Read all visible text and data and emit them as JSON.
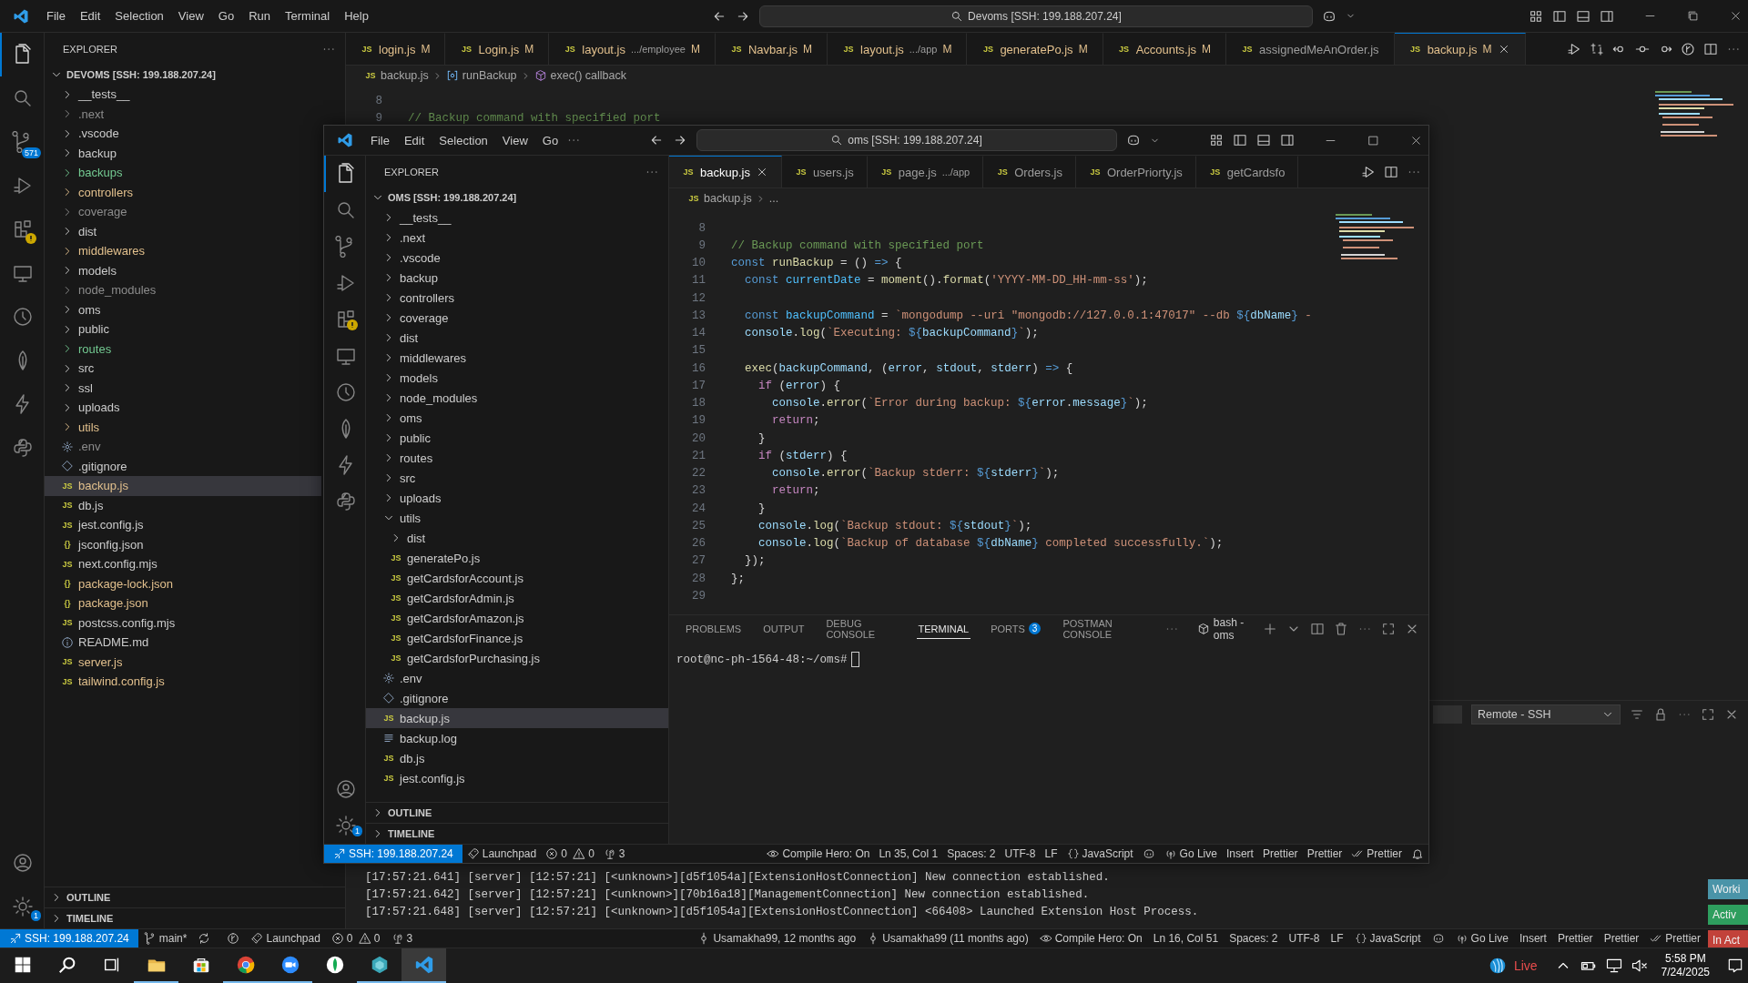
{
  "windows": [
    {
      "kind": "main",
      "maximized": true,
      "menu_overflow": false,
      "menu": [
        "File",
        "Edit",
        "Selection",
        "View",
        "Go",
        "Run",
        "Terminal",
        "Help"
      ],
      "search": "Devoms [SSH: 199.188.207.24]",
      "activity": [
        {
          "kind": "files",
          "selected": true
        },
        {
          "kind": "search",
          "selected": false
        },
        {
          "kind": "scm",
          "selected": false,
          "badge": "571"
        },
        {
          "kind": "run",
          "selected": false
        },
        {
          "kind": "extensions",
          "selected": false,
          "warning": true
        },
        {
          "kind": "remote",
          "selected": false
        },
        {
          "kind": "clock",
          "selected": false
        },
        {
          "kind": "leaf",
          "selected": false
        },
        {
          "kind": "bolt",
          "selected": false
        },
        {
          "kind": "snakes",
          "selected": false
        }
      ],
      "activity_bottom": [
        {
          "kind": "account"
        },
        {
          "kind": "settings",
          "badge": "1"
        }
      ],
      "explorer": {
        "title": "EXPLORER",
        "root": "DEVOMS [SSH: 199.188.207.24]",
        "sections": [
          "OUTLINE",
          "TIMELINE"
        ],
        "items": [
          {
            "name": "__tests__",
            "kind": "folder",
            "expanded": false,
            "selected": false
          },
          {
            "name": ".next",
            "kind": "folder",
            "expanded": false,
            "selected": false,
            "color": "#8c8c8c"
          },
          {
            "name": ".vscode",
            "kind": "folder",
            "expanded": false,
            "selected": false
          },
          {
            "name": "backup",
            "kind": "folder",
            "expanded": false,
            "selected": false
          },
          {
            "name": "backups",
            "kind": "folder",
            "expanded": false,
            "selected": false,
            "color": "#73c991"
          },
          {
            "name": "controllers",
            "kind": "folder",
            "expanded": false,
            "selected": false,
            "color": "#e2c08d"
          },
          {
            "name": "coverage",
            "kind": "folder",
            "expanded": false,
            "selected": false,
            "color": "#8c8c8c"
          },
          {
            "name": "dist",
            "kind": "folder",
            "expanded": false,
            "selected": false
          },
          {
            "name": "middlewares",
            "kind": "folder",
            "expanded": false,
            "selected": false,
            "color": "#e2c08d"
          },
          {
            "name": "models",
            "kind": "folder",
            "expanded": false,
            "selected": false
          },
          {
            "name": "node_modules",
            "kind": "folder",
            "expanded": false,
            "selected": false,
            "color": "#8c8c8c"
          },
          {
            "name": "oms",
            "kind": "folder",
            "expanded": false,
            "selected": false
          },
          {
            "name": "public",
            "kind": "folder",
            "expanded": false,
            "selected": false
          },
          {
            "name": "routes",
            "kind": "folder",
            "expanded": false,
            "selected": false,
            "color": "#73c991"
          },
          {
            "name": "src",
            "kind": "folder",
            "expanded": false,
            "selected": false
          },
          {
            "name": "ssl",
            "kind": "folder",
            "expanded": false,
            "selected": false
          },
          {
            "name": "uploads",
            "kind": "folder",
            "expanded": false,
            "selected": false
          },
          {
            "name": "utils",
            "kind": "folder",
            "expanded": false,
            "selected": false,
            "color": "#e2c08d"
          },
          {
            "name": ".env",
            "kind": "env",
            "selected": false,
            "color": "#8c8c8c"
          },
          {
            "name": ".gitignore",
            "kind": "git",
            "selected": false
          },
          {
            "name": "backup.js",
            "kind": "js",
            "glyph": "JS",
            "selected": true,
            "color": "#e2c08d"
          },
          {
            "name": "db.js",
            "kind": "js",
            "glyph": "JS",
            "selected": false
          },
          {
            "name": "jest.config.js",
            "kind": "js",
            "glyph": "JS",
            "selected": false
          },
          {
            "name": "jsconfig.json",
            "kind": "json",
            "glyph": "{}",
            "selected": false
          },
          {
            "name": "next.config.mjs",
            "kind": "js",
            "glyph": "JS",
            "selected": false
          },
          {
            "name": "package-lock.json",
            "kind": "json",
            "glyph": "{}",
            "selected": false,
            "color": "#e2c08d"
          },
          {
            "name": "package.json",
            "kind": "json",
            "glyph": "{}",
            "selected": false,
            "color": "#e2c08d"
          },
          {
            "name": "postcss.config.mjs",
            "kind": "js",
            "glyph": "JS",
            "selected": false
          },
          {
            "name": "README.md",
            "kind": "info",
            "selected": false
          },
          {
            "name": "server.js",
            "kind": "js",
            "glyph": "JS",
            "selected": false,
            "color": "#e2c08d"
          },
          {
            "name": "tailwind.config.js",
            "kind": "js",
            "glyph": "JS",
            "selected": false,
            "color": "#e2c08d"
          }
        ]
      },
      "tabs": [
        {
          "name": "login.js",
          "glyph": "JS",
          "status": "M",
          "selected": false
        },
        {
          "name": "Login.js",
          "glyph": "JS",
          "status": "M",
          "selected": false
        },
        {
          "name": "layout.js",
          "detail": ".../employee",
          "glyph": "JS",
          "status": "M",
          "selected": false
        },
        {
          "name": "Navbar.js",
          "glyph": "JS",
          "status": "M",
          "selected": false
        },
        {
          "name": "layout.js",
          "detail": ".../app",
          "glyph": "JS",
          "status": "M",
          "selected": false
        },
        {
          "name": "generatePo.js",
          "glyph": "JS",
          "status": "M",
          "selected": false
        },
        {
          "name": "Accounts.js",
          "glyph": "JS",
          "status": "M",
          "selected": false
        },
        {
          "name": "assignedMeAnOrder.js",
          "glyph": "JS",
          "selected": false
        },
        {
          "name": "backup.js",
          "glyph": "JS",
          "status": "M",
          "selected": true
        }
      ],
      "tab_actions": [
        {
          "kind": "run"
        },
        {
          "kind": "compare"
        },
        {
          "kind": "back"
        },
        {
          "kind": "dot"
        },
        {
          "kind": "forward"
        },
        {
          "kind": "graph"
        },
        {
          "kind": "split"
        },
        {
          "kind": "more"
        }
      ],
      "breadcrumb": [
        {
          "glyph": "JS",
          "text": "backup.js"
        },
        {
          "kind": "method",
          "text": "runBackup"
        },
        {
          "kind": "function",
          "text": "exec() callback"
        }
      ],
      "code": [
        {
          "num": "8"
        },
        {
          "num": "9",
          "text": "// Backup command with specified port"
        }
      ],
      "panel": {
        "kind": "output",
        "dropdown": "Remote - SSH",
        "lines": [
          "[17:57:21.641] [server] [12:57:21] [<unknown>][d5f1054a][ExtensionHostConnection] New connection established.",
          "[17:57:21.642] [server] [12:57:21] [<unknown>][70b16a18][ManagementConnection] New connection established.",
          "[17:57:21.648] [server] [12:57:21] [<unknown>][d5f1054a][ExtensionHostConnection] <66408> Launched Extension Host Process."
        ]
      },
      "status_left": [
        {
          "kind": "remote",
          "text": "SSH: 199.188.207.24"
        },
        {
          "kind": "branch",
          "text": "main*"
        },
        {
          "kind": "sync"
        },
        {
          "kind": "graph"
        },
        {
          "kind": "launchpad",
          "text": "Launchpad"
        },
        {
          "kind": "problems",
          "errors": "0",
          "warnings": "0"
        },
        {
          "kind": "ports",
          "text": "3"
        }
      ],
      "status_right": [
        {
          "kind": "blame",
          "text": "Usamakha99, 12 months ago"
        },
        {
          "kind": "blame",
          "text": "Usamakha99 (11 months ago)"
        },
        {
          "kind": "eye",
          "text": "Compile Hero: On"
        },
        {
          "kind": "text",
          "text": "Ln 16, Col 51"
        },
        {
          "kind": "text",
          "text": "Spaces: 2"
        },
        {
          "kind": "text",
          "text": "UTF-8"
        },
        {
          "kind": "text",
          "text": "LF"
        },
        {
          "kind": "language",
          "text": "JavaScript"
        },
        {
          "kind": "copilot"
        },
        {
          "kind": "golive",
          "text": "Go Live"
        },
        {
          "kind": "text",
          "text": "Insert"
        },
        {
          "kind": "text",
          "text": "Prettier"
        },
        {
          "kind": "text",
          "text": "Prettier"
        },
        {
          "kind": "checks",
          "text": "Prettier"
        }
      ]
    },
    {
      "kind": "floating",
      "maximized": false,
      "menu_overflow": true,
      "menu": [
        "File",
        "Edit",
        "Selection",
        "View",
        "Go"
      ],
      "search": "oms [SSH: 199.188.207.24]",
      "activity": [
        {
          "kind": "files",
          "selected": true
        },
        {
          "kind": "search",
          "selected": false
        },
        {
          "kind": "scm",
          "selected": false
        },
        {
          "kind": "run",
          "selected": false
        },
        {
          "kind": "extensions",
          "selected": false,
          "warning": true
        },
        {
          "kind": "remote",
          "selected": false
        },
        {
          "kind": "clock",
          "selected": false
        },
        {
          "kind": "leaf",
          "selected": false
        },
        {
          "kind": "bolt",
          "selected": false
        },
        {
          "kind": "snakes",
          "selected": false
        }
      ],
      "activity_bottom": [
        {
          "kind": "account"
        },
        {
          "kind": "settings",
          "badge": "1"
        }
      ],
      "explorer": {
        "title": "EXPLORER",
        "root": "OMS [SSH: 199.188.207.24]",
        "sections": [
          "OUTLINE",
          "TIMELINE"
        ],
        "items": [
          {
            "name": "__tests__",
            "kind": "folder",
            "expanded": false,
            "selected": false
          },
          {
            "name": ".next",
            "kind": "folder",
            "expanded": false,
            "selected": false
          },
          {
            "name": ".vscode",
            "kind": "folder",
            "expanded": false,
            "selected": false
          },
          {
            "name": "backup",
            "kind": "folder",
            "expanded": false,
            "selected": false
          },
          {
            "name": "controllers",
            "kind": "folder",
            "expanded": false,
            "selected": false
          },
          {
            "name": "coverage",
            "kind": "folder",
            "expanded": false,
            "selected": false
          },
          {
            "name": "dist",
            "kind": "folder",
            "expanded": false,
            "selected": false
          },
          {
            "name": "middlewares",
            "kind": "folder",
            "expanded": false,
            "selected": false
          },
          {
            "name": "models",
            "kind": "folder",
            "expanded": false,
            "selected": false
          },
          {
            "name": "node_modules",
            "kind": "folder",
            "expanded": false,
            "selected": false
          },
          {
            "name": "oms",
            "kind": "folder",
            "expanded": false,
            "selected": false
          },
          {
            "name": "public",
            "kind": "folder",
            "expanded": false,
            "selected": false
          },
          {
            "name": "routes",
            "kind": "folder",
            "expanded": false,
            "selected": false
          },
          {
            "name": "src",
            "kind": "folder",
            "expanded": false,
            "selected": false
          },
          {
            "name": "uploads",
            "kind": "folder",
            "expanded": false,
            "selected": false
          },
          {
            "name": "utils",
            "kind": "folder",
            "expanded": true,
            "selected": false,
            "children": [
              {
                "name": "dist",
                "kind": "folder",
                "expanded": false,
                "selected": false
              },
              {
                "name": "generatePo.js",
                "kind": "js",
                "glyph": "JS",
                "selected": false
              },
              {
                "name": "getCardsforAccount.js",
                "kind": "js",
                "glyph": "JS",
                "selected": false
              },
              {
                "name": "getCardsforAdmin.js",
                "kind": "js",
                "glyph": "JS",
                "selected": false
              },
              {
                "name": "getCardsforAmazon.js",
                "kind": "js",
                "glyph": "JS",
                "selected": false
              },
              {
                "name": "getCardsforFinance.js",
                "kind": "js",
                "glyph": "JS",
                "selected": false
              },
              {
                "name": "getCardsforPurchasing.js",
                "kind": "js",
                "glyph": "JS",
                "selected": false
              }
            ]
          },
          {
            "name": ".env",
            "kind": "env",
            "selected": false
          },
          {
            "name": ".gitignore",
            "kind": "git",
            "selected": false
          },
          {
            "name": "backup.js",
            "kind": "js",
            "glyph": "JS",
            "selected": true
          },
          {
            "name": "backup.log",
            "kind": "log",
            "selected": false
          },
          {
            "name": "db.js",
            "kind": "js",
            "glyph": "JS",
            "selected": false
          },
          {
            "name": "jest.config.js",
            "kind": "js",
            "glyph": "JS",
            "selected": false
          }
        ]
      },
      "tabs": [
        {
          "name": "backup.js",
          "glyph": "JS",
          "selected": true
        },
        {
          "name": "users.js",
          "glyph": "JS",
          "selected": false
        },
        {
          "name": "page.js",
          "detail": ".../app",
          "glyph": "JS",
          "selected": false
        },
        {
          "name": "Orders.js",
          "glyph": "JS",
          "selected": false
        },
        {
          "name": "OrderPriorty.js",
          "glyph": "JS",
          "selected": false
        },
        {
          "name": "getCardsfo",
          "glyph": "JS",
          "selected": false
        }
      ],
      "tab_actions": [
        {
          "kind": "run"
        },
        {
          "kind": "split"
        },
        {
          "kind": "more"
        }
      ],
      "breadcrumb": [
        {
          "glyph": "JS",
          "text": "backup.js"
        },
        {
          "text": "..."
        }
      ],
      "code": [
        {
          "num": "8"
        },
        {
          "num": "9",
          "text": "// Backup command with specified port"
        },
        {
          "num": "10",
          "text": "const runBackup = () => {"
        },
        {
          "num": "11",
          "text": "  const currentDate = moment().format('YYYY-MM-DD_HH-mm-ss');"
        },
        {
          "num": "12"
        },
        {
          "num": "13",
          "text": "  const backupCommand = `mongodump --uri \"mongodb://127.0.0.1:47017\" --db ${dbName} -"
        },
        {
          "num": "14",
          "text": "  console.log(`Executing: ${backupCommand}`);"
        },
        {
          "num": "15"
        },
        {
          "num": "16",
          "text": "  exec(backupCommand, (error, stdout, stderr) => {"
        },
        {
          "num": "17",
          "text": "    if (error) {"
        },
        {
          "num": "18",
          "text": "      console.error(`Error during backup: ${error.message}`);"
        },
        {
          "num": "19",
          "text": "      return;"
        },
        {
          "num": "20",
          "text": "    }"
        },
        {
          "num": "21",
          "text": "    if (stderr) {"
        },
        {
          "num": "22",
          "text": "      console.error(`Backup stderr: ${stderr}`);"
        },
        {
          "num": "23",
          "text": "      return;"
        },
        {
          "num": "24",
          "text": "    }"
        },
        {
          "num": "25",
          "text": "    console.log(`Backup stdout: ${stdout}`);"
        },
        {
          "num": "26",
          "text": "    console.log(`Backup of database ${dbName} completed successfully.`);"
        },
        {
          "num": "27",
          "text": "  });"
        },
        {
          "num": "28",
          "text": "};"
        },
        {
          "num": "29"
        }
      ],
      "panel": {
        "kind": "terminal",
        "shell": "bash - oms",
        "prompt": "root@nc-ph-1564-48:~/oms#",
        "tabs": [
          {
            "label": "PROBLEMS",
            "selected": false
          },
          {
            "label": "OUTPUT",
            "selected": false
          },
          {
            "label": "DEBUG CONSOLE",
            "selected": false
          },
          {
            "label": "TERMINAL",
            "selected": true
          },
          {
            "label": "PORTS",
            "selected": false,
            "badge": "3"
          },
          {
            "label": "POSTMAN CONSOLE",
            "selected": false
          }
        ]
      },
      "status_left": [
        {
          "kind": "remote",
          "text": "SSH: 199.188.207.24"
        },
        {
          "kind": "launchpad",
          "text": "Launchpad"
        },
        {
          "kind": "problems",
          "errors": "0",
          "warnings": "0"
        },
        {
          "kind": "ports",
          "text": "3"
        }
      ],
      "status_right": [
        {
          "kind": "eye",
          "text": "Compile Hero: On"
        },
        {
          "kind": "text",
          "text": "Ln 35, Col 1"
        },
        {
          "kind": "text",
          "text": "Spaces: 2"
        },
        {
          "kind": "text",
          "text": "UTF-8"
        },
        {
          "kind": "text",
          "text": "LF"
        },
        {
          "kind": "language",
          "text": "JavaScript"
        },
        {
          "kind": "copilot"
        },
        {
          "kind": "golive",
          "text": "Go Live"
        },
        {
          "kind": "text",
          "text": "Insert"
        },
        {
          "kind": "text",
          "text": "Prettier"
        },
        {
          "kind": "text",
          "text": "Prettier"
        },
        {
          "kind": "checks",
          "text": "Prettier"
        },
        {
          "kind": "bell"
        }
      ]
    }
  ],
  "notifications": [
    {
      "text": "Worki",
      "color": "#4a94a8"
    },
    {
      "text": "Activ",
      "color": "#2e9e5e"
    },
    {
      "text": "In Act",
      "color": "#c2423a"
    }
  ],
  "taskbar": {
    "apps": [
      {
        "kind": "start",
        "running": false
      },
      {
        "kind": "search",
        "running": false
      },
      {
        "kind": "taskview",
        "running": false
      },
      {
        "kind": "folder",
        "running": true
      },
      {
        "kind": "store",
        "running": false
      },
      {
        "kind": "browser",
        "running": true
      },
      {
        "kind": "video",
        "running": true
      },
      {
        "kind": "leaf",
        "running": false
      },
      {
        "kind": "hexagon",
        "running": true
      },
      {
        "kind": "editor",
        "running": true,
        "selected": true
      }
    ],
    "live": "Live",
    "time": "5:58 PM",
    "date": "7/24/2025"
  }
}
